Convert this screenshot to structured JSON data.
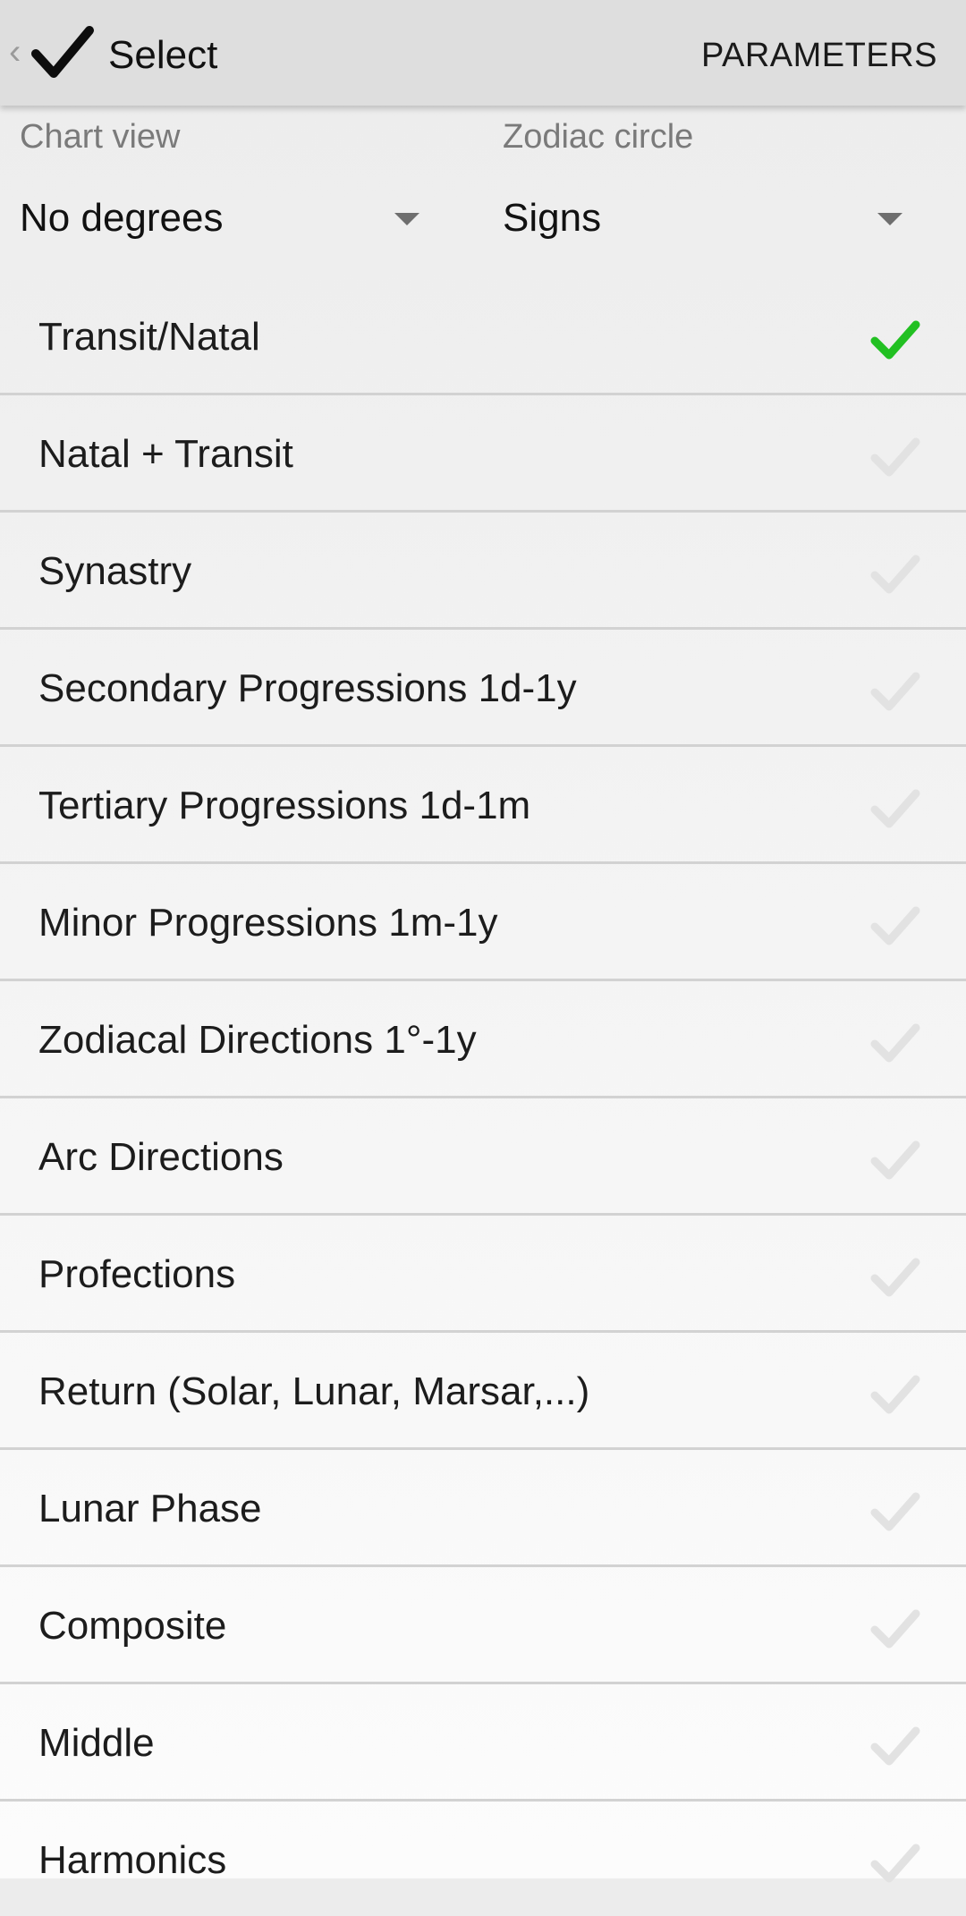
{
  "appbar": {
    "back_icon": "chevron-left-icon",
    "confirm_icon": "checkmark-icon",
    "title": "Select",
    "action_label": "PARAMETERS"
  },
  "dropdowns": {
    "chart_view": {
      "label": "Chart view",
      "value": "No degrees"
    },
    "zodiac_circle": {
      "label": "Zodiac circle",
      "value": "Signs"
    }
  },
  "colors": {
    "selected_check": "#22c022",
    "unselected_check": "#e2e2e2",
    "divider": "#d2d2d2"
  },
  "items": [
    {
      "label": "Transit/Natal",
      "selected": true
    },
    {
      "label": "Natal + Transit",
      "selected": false
    },
    {
      "label": "Synastry",
      "selected": false
    },
    {
      "label": "Secondary Progressions 1d-1y",
      "selected": false
    },
    {
      "label": "Tertiary Progressions 1d-1m",
      "selected": false
    },
    {
      "label": "Minor Progressions 1m-1y",
      "selected": false
    },
    {
      "label": "Zodiacal Directions 1°-1y",
      "selected": false
    },
    {
      "label": "Arc Directions",
      "selected": false
    },
    {
      "label": "Profections",
      "selected": false
    },
    {
      "label": "Return (Solar, Lunar, Marsar,...)",
      "selected": false
    },
    {
      "label": "Lunar Phase",
      "selected": false
    },
    {
      "label": "Composite",
      "selected": false
    },
    {
      "label": "Middle",
      "selected": false
    },
    {
      "label": "Harmonics",
      "selected": false
    }
  ]
}
